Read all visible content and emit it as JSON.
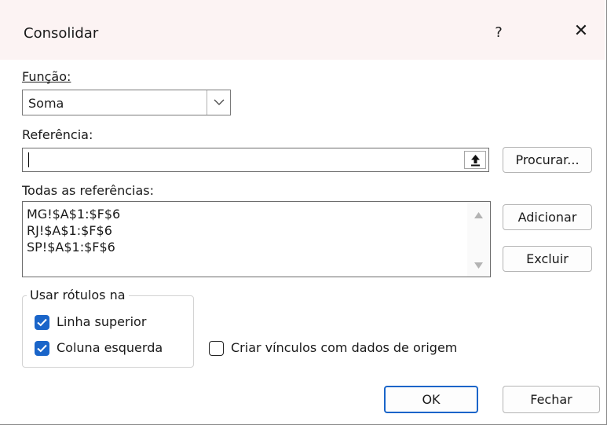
{
  "window": {
    "title": "Consolidar",
    "help": "?",
    "close": "✕"
  },
  "funcao": {
    "label": "Função:",
    "value": "Soma"
  },
  "referencia": {
    "label": "Referência:",
    "value": "",
    "browse_button": "Procurar..."
  },
  "todas": {
    "label": "Todas as referências:",
    "items": [
      "MG!$A$1:$F$6",
      "RJ!$A$1:$F$6",
      "SP!$A$1:$F$6"
    ],
    "add_button": "Adicionar",
    "delete_button": "Excluir"
  },
  "rotulos": {
    "title": "Usar rótulos na",
    "linha_superior": {
      "label": "Linha superior",
      "checked": true
    },
    "coluna_esquerda": {
      "label": "Coluna esquerda",
      "checked": true
    }
  },
  "vinculos": {
    "label": "Criar vínculos com dados de origem",
    "checked": false
  },
  "footer": {
    "ok": "OK",
    "close": "Fechar"
  },
  "colors": {
    "accent": "#1a65c9",
    "titlebar": "#fcf3f3"
  },
  "icons": {
    "help": "question-mark",
    "close": "close-x",
    "dropdown": "chevron-down",
    "collapse": "up-arrow",
    "scroll_up": "triangle-up",
    "scroll_down": "triangle-down",
    "check": "checkmark"
  }
}
